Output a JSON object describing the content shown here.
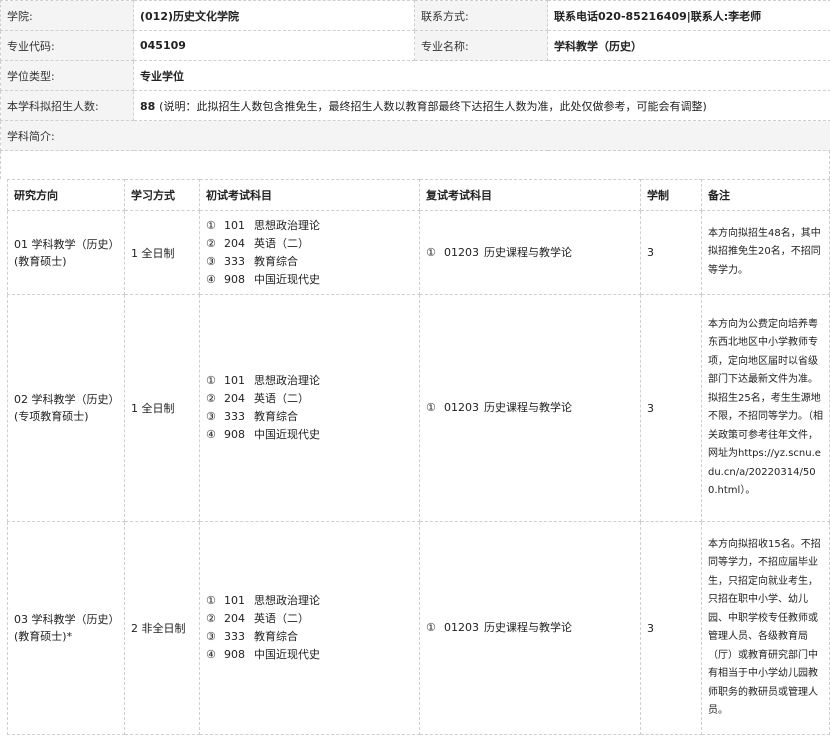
{
  "info": {
    "college_label": "学院:",
    "college_value": "(012)历史文化学院",
    "contact_label": "联系方式:",
    "contact_value": "联系电话020-85216409|联系人:李老师",
    "major_code_label": "专业代码:",
    "major_code_value": "045109",
    "major_name_label": "专业名称:",
    "major_name_value": "学科教学（历史）",
    "degree_type_label": "学位类型:",
    "degree_type_value": "专业学位",
    "enroll_label": "本学科拟招生人数:",
    "enroll_value": "88",
    "enroll_note": "(说明：此拟招生人数包含推免生，最终招生人数以教育部最终下达招生人数为准，此处仅做参考，可能会有调整)",
    "intro_label": "学科简介:"
  },
  "table": {
    "headers": {
      "direction": "研究方向",
      "mode": "学习方式",
      "initial": "初试考试科目",
      "retest": "复试考试科目",
      "years": "学制",
      "remark": "备注"
    },
    "rows": [
      {
        "direction_line1": "01 学科教学（历史）",
        "direction_line2": "(教育硕士)",
        "mode": "1 全日制",
        "subjects": [
          {
            "num": "①",
            "code": "101",
            "name": "思想政治理论"
          },
          {
            "num": "②",
            "code": "204",
            "name": "英语（二）"
          },
          {
            "num": "③",
            "code": "333",
            "name": "教育综合"
          },
          {
            "num": "④",
            "code": "908",
            "name": "中国近现代史"
          }
        ],
        "retest": {
          "num": "①",
          "code": "01203",
          "name": "历史课程与教学论"
        },
        "years": "3",
        "remark": "本方向拟招生48名，其中拟招推免生20名，不招同等学力。"
      },
      {
        "direction_line1": "02 学科教学（历史）",
        "direction_line2": "(专项教育硕士)",
        "mode": "1 全日制",
        "subjects": [
          {
            "num": "①",
            "code": "101",
            "name": "思想政治理论"
          },
          {
            "num": "②",
            "code": "204",
            "name": "英语（二）"
          },
          {
            "num": "③",
            "code": "333",
            "name": "教育综合"
          },
          {
            "num": "④",
            "code": "908",
            "name": "中国近现代史"
          }
        ],
        "retest": {
          "num": "①",
          "code": "01203",
          "name": "历史课程与教学论"
        },
        "years": "3",
        "remark": "本方向为公费定向培养粤东西北地区中小学教师专项，定向地区届时以省级部门下达最新文件为准。拟招生25名，考生生源地不限，不招同等学力。（相关政策可参考往年文件，网址为https://yz.scnu.edu.cn/a/20220314/500.html）。"
      },
      {
        "direction_line1": "03 学科教学（历史）",
        "direction_line2": "(教育硕士)*",
        "mode": "2 非全日制",
        "subjects": [
          {
            "num": "①",
            "code": "101",
            "name": "思想政治理论"
          },
          {
            "num": "②",
            "code": "204",
            "name": "英语（二）"
          },
          {
            "num": "③",
            "code": "333",
            "name": "教育综合"
          },
          {
            "num": "④",
            "code": "908",
            "name": "中国近现代史"
          }
        ],
        "retest": {
          "num": "①",
          "code": "01203",
          "name": "历史课程与教学论"
        },
        "years": "3",
        "remark": "本方向拟招收15名。不招同等学力，不招应届毕业生，只招定向就业考生，只招在职中小学、幼儿园、中职学校专任教师或管理人员、各级教育局（厅）或教育研究部门中有相当于中小学幼儿园教师职务的教研员或管理人员。"
      }
    ]
  }
}
